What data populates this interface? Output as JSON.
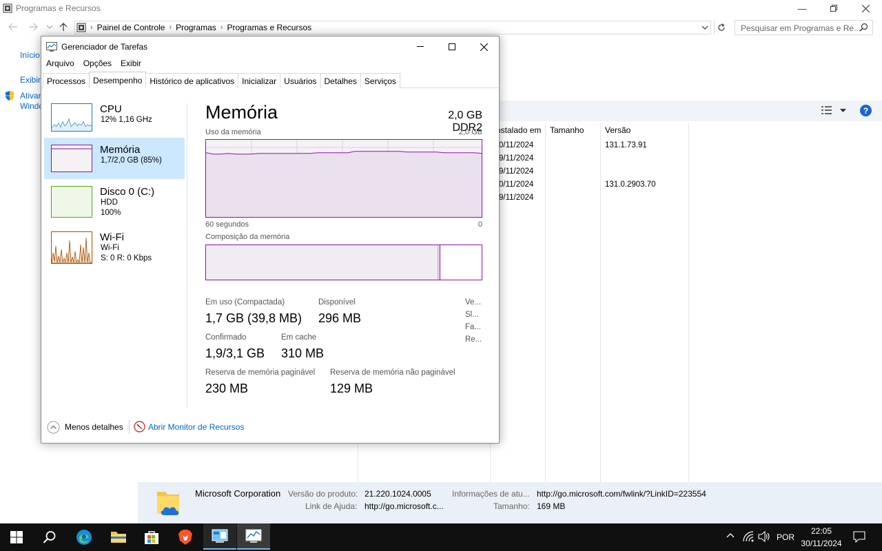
{
  "explorer": {
    "title": "Programas e Recursos",
    "breadcrumb": [
      "Painel de Controle",
      "Programas",
      "Programas e Recursos"
    ],
    "search_placeholder": "Pesquisar em Programas e Re...",
    "left_links": [
      "Início",
      "Exibir",
      "Ativar",
      "Windo"
    ],
    "columns": [
      "nstalado em",
      "Tamanho",
      "Versão"
    ],
    "rows": [
      {
        "installed": "0/11/2024",
        "size": "",
        "version": "131.1.73.91"
      },
      {
        "installed": "9/11/2024",
        "size": "",
        "version": ""
      },
      {
        "installed": "9/11/2024",
        "size": "",
        "version": ""
      },
      {
        "installed": "0/11/2024",
        "size": "",
        "version": "131.0.2903.70"
      },
      {
        "installed": "9/11/2024",
        "size": "",
        "version": ""
      }
    ],
    "details": {
      "publisher": "Microsoft Corporation",
      "product_version_label": "Versão do produto:",
      "product_version": "21.220.1024.0005",
      "help_link_label": "Link de Ajuda:",
      "help_link": "http://go.microsoft.c...",
      "update_info_label": "Informações de atu...",
      "update_info": "http://go.microsoft.com/fwlink/?LinkID=223554",
      "size_label": "Tamanho:",
      "size": "169 MB"
    }
  },
  "taskmgr": {
    "title": "Gerenciador de Tarefas",
    "menu": [
      "Arquivo",
      "Opções",
      "Exibir"
    ],
    "tabs": [
      "Processos",
      "Desempenho",
      "Histórico de aplicativos",
      "Inicializar",
      "Usuários",
      "Detalhes",
      "Serviços"
    ],
    "active_tab": "Desempenho",
    "sidebar": [
      {
        "name": "CPU",
        "line1": "12%  1,16 GHz",
        "line2": ""
      },
      {
        "name": "Memória",
        "line1": "1,7/2,0 GB (85%)",
        "line2": ""
      },
      {
        "name": "Disco 0 (C:)",
        "line1": "HDD",
        "line2": "100%"
      },
      {
        "name": "Wi-Fi",
        "line1": "Wi-Fi",
        "line2": "S: 0 R: 0 Kbps"
      }
    ],
    "panel": {
      "heading": "Memória",
      "spec": "2,0 GB DDR2",
      "usage_label": "Uso da memória",
      "usage_max": "2,0 GB",
      "time_left": "60 segundos",
      "time_right": "0",
      "usage_level": 0.85,
      "composition_label": "Composição da memória",
      "composition_in_use_fraction": 0.85,
      "stats": [
        {
          "label": "Em uso (Compactada)",
          "value": "1,7 GB (39,8 MB)"
        },
        {
          "label": "Disponível",
          "value": "296 MB"
        },
        {
          "label": "Confirmado",
          "value": "1,9/3,1 GB"
        },
        {
          "label": "Em cache",
          "value": "310 MB"
        },
        {
          "label": "Reserva de memória paginável",
          "value": "230 MB"
        },
        {
          "label": "Reserva de memória não paginável",
          "value": "129 MB"
        }
      ],
      "truncated": [
        "Ve...",
        "Sl...",
        "Fa...",
        "Re..."
      ]
    },
    "footer": {
      "less_details": "Menos detalhes",
      "resource_monitor": "Abrir Monitor de Recursos"
    }
  },
  "taskbar": {
    "language": "POR",
    "time": "22:05",
    "date": "30/11/2024"
  },
  "colors": {
    "memory_purple": "#8b12ae",
    "cpu_blue": "#117dbb",
    "disk_green": "#4da60c",
    "wifi_orange": "#a74f01",
    "selection": "#cce8ff",
    "link": "#0066cc"
  }
}
